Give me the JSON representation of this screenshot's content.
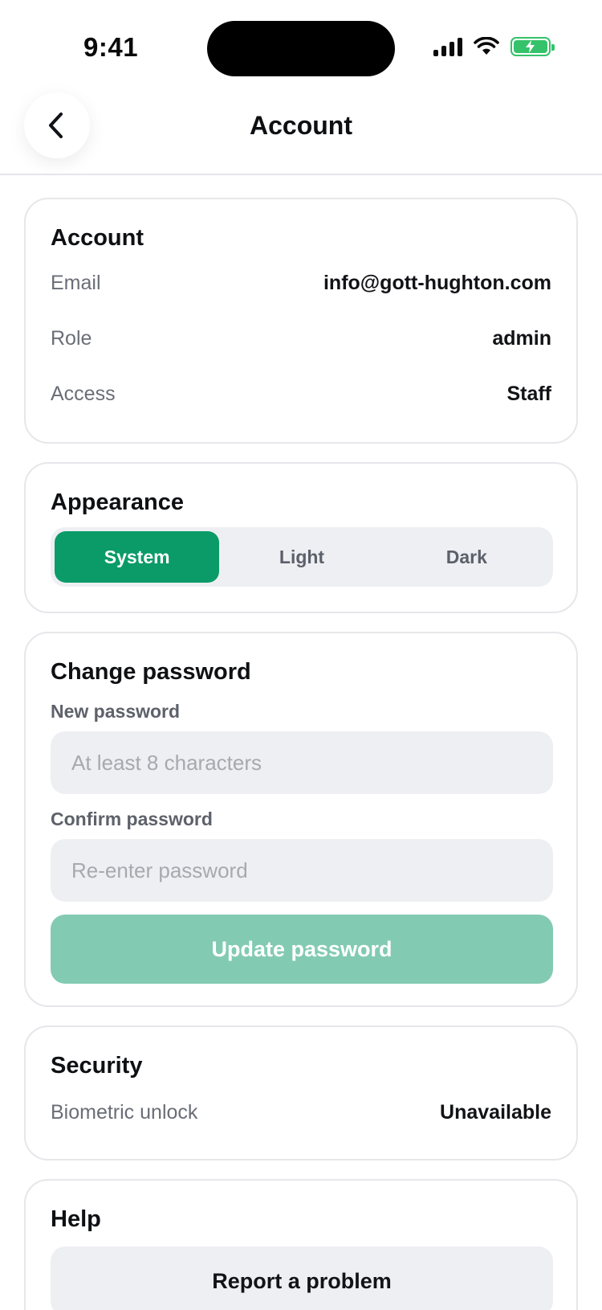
{
  "status_bar": {
    "time": "9:41",
    "icons": [
      "cellular-signal-icon",
      "wifi-icon",
      "battery-charging-icon"
    ],
    "battery_color": "#35c26a"
  },
  "nav": {
    "title": "Account",
    "back_icon": "chevron-left-icon"
  },
  "account": {
    "title": "Account",
    "rows": [
      {
        "label": "Email",
        "value": "info@gott-hughton.com"
      },
      {
        "label": "Role",
        "value": "admin"
      },
      {
        "label": "Access",
        "value": "Staff"
      }
    ]
  },
  "appearance": {
    "title": "Appearance",
    "options": [
      "System",
      "Light",
      "Dark"
    ],
    "selected": "System",
    "accent": "#0a9b69"
  },
  "change_password": {
    "title": "Change password",
    "new_label": "New password",
    "new_placeholder": "At least 8 characters",
    "confirm_label": "Confirm password",
    "confirm_placeholder": "Re-enter password",
    "button_label": "Update password",
    "button_color": "#82cbb2"
  },
  "security": {
    "title": "Security",
    "rows": [
      {
        "label": "Biometric unlock",
        "value": "Unavailable"
      }
    ]
  },
  "help": {
    "title": "Help",
    "button_label": "Report a problem"
  }
}
